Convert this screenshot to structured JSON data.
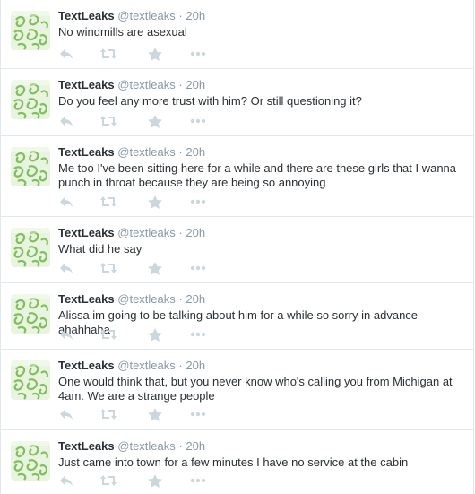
{
  "colors": {
    "text": "#292f33",
    "meta": "#8899a6",
    "action_icon": "#ccd6dd",
    "divider": "#e1e8ed",
    "avatar_bg": "#e8f4df",
    "avatar_green": "#6fb447"
  },
  "icons": {
    "reply": "reply-icon",
    "retweet": "retweet-icon",
    "favorite": "star-icon",
    "more": "more-icon"
  },
  "tweets": [
    {
      "fullname": "TextLeaks",
      "username": "@textleaks",
      "separator": "·",
      "time": "20h",
      "text": "No windmills are asexual"
    },
    {
      "fullname": "TextLeaks",
      "username": "@textleaks",
      "separator": "·",
      "time": "20h",
      "text": "Do you feel any more trust with him? Or still questioning it?"
    },
    {
      "fullname": "TextLeaks",
      "username": "@textleaks",
      "separator": "·",
      "time": "20h",
      "text": "Me too I've been sitting here for a while and there are these girls that I wanna punch in throat because they are being so annoying"
    },
    {
      "fullname": "TextLeaks",
      "username": "@textleaks",
      "separator": "·",
      "time": "20h",
      "text": "What did he say"
    },
    {
      "fullname": "TextLeaks",
      "username": "@textleaks",
      "separator": "·",
      "time": "20h",
      "text": "Alissa im going to be talking about him for a while so sorry in advance ahahhaha"
    },
    {
      "fullname": "TextLeaks",
      "username": "@textleaks",
      "separator": "·",
      "time": "20h",
      "text": "One would think that, but you never know who's calling you from Michigan at 4am. We are a strange people"
    },
    {
      "fullname": "TextLeaks",
      "username": "@textleaks",
      "separator": "·",
      "time": "20h",
      "text": "Just came into town for a few minutes I have no service at the cabin"
    }
  ]
}
